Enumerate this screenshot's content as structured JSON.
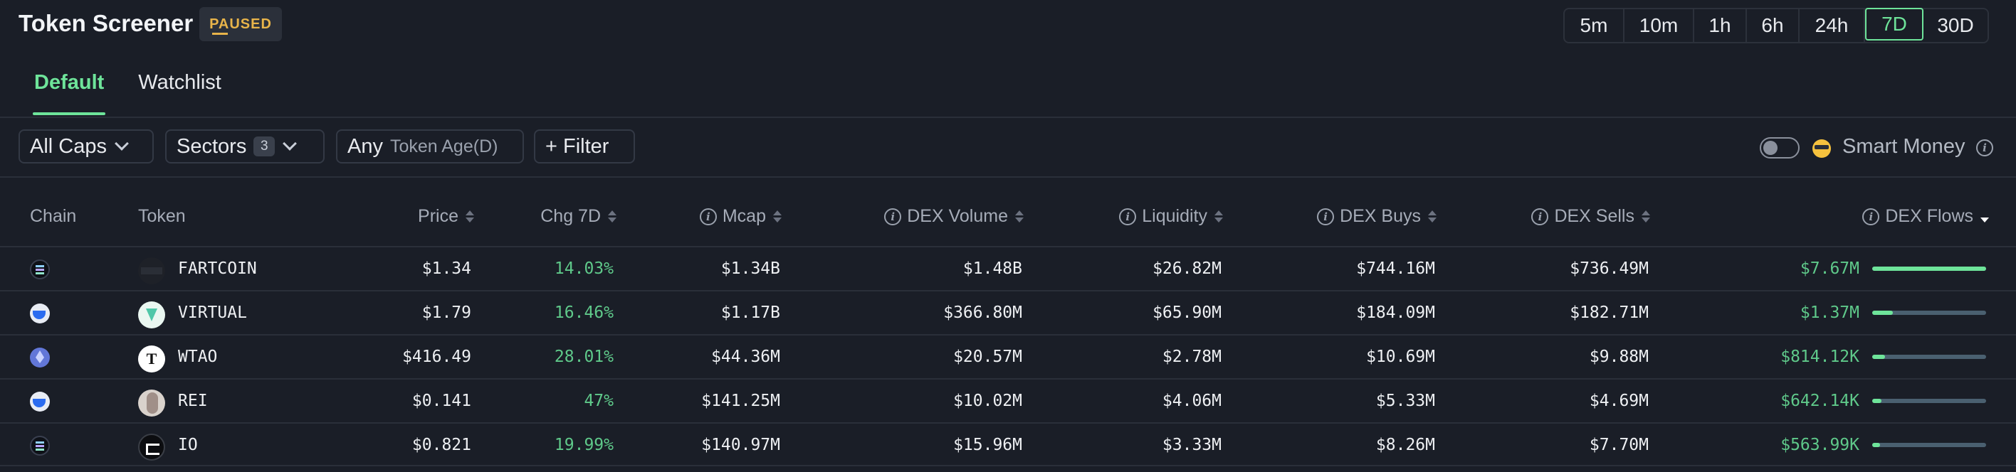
{
  "header": {
    "title": "Token Screener",
    "badge": "PAUSED",
    "timeframes": [
      "5m",
      "10m",
      "1h",
      "6h",
      "24h",
      "7D",
      "30D"
    ],
    "active_timeframe": "7D"
  },
  "tabs": [
    {
      "label": "Default",
      "active": true
    },
    {
      "label": "Watchlist",
      "active": false
    }
  ],
  "filters": {
    "caps": "All Caps",
    "sectors": "Sectors",
    "sectors_count": "3",
    "age_prefix": "Any",
    "age_label": "Token Age(D)",
    "filter_label": "+ Filter",
    "smart_money_label": "Smart Money",
    "smart_money_enabled": false
  },
  "columns": {
    "chain": "Chain",
    "token": "Token",
    "price": "Price",
    "chg": "Chg 7D",
    "mcap": "Mcap",
    "volume": "DEX Volume",
    "liquidity": "Liquidity",
    "buys": "DEX Buys",
    "sells": "DEX Sells",
    "flows": "DEX Flows"
  },
  "rows": [
    {
      "chain": "solana-icon",
      "token": "FARTCOIN",
      "price": "$1.34",
      "chg": "14.03%",
      "mcap": "$1.34B",
      "volume": "$1.48B",
      "liquidity": "$26.82M",
      "buys": "$744.16M",
      "sells": "$736.49M",
      "flows": "$7.67M",
      "flow_level": 1.0
    },
    {
      "chain": "base-icon",
      "token": "VIRTUAL",
      "price": "$1.79",
      "chg": "16.46%",
      "mcap": "$1.17B",
      "volume": "$366.80M",
      "liquidity": "$65.90M",
      "buys": "$184.09M",
      "sells": "$182.71M",
      "flows": "$1.37M",
      "flow_level": 0.18
    },
    {
      "chain": "ethereum-icon",
      "token": "WTAO",
      "price": "$416.49",
      "chg": "28.01%",
      "mcap": "$44.36M",
      "volume": "$20.57M",
      "liquidity": "$2.78M",
      "buys": "$10.69M",
      "sells": "$9.88M",
      "flows": "$814.12K",
      "flow_level": 0.11
    },
    {
      "chain": "base-icon",
      "token": "REI",
      "price": "$0.141",
      "chg": "47%",
      "mcap": "$141.25M",
      "volume": "$10.02M",
      "liquidity": "$4.06M",
      "buys": "$5.33M",
      "sells": "$4.69M",
      "flows": "$642.14K",
      "flow_level": 0.08
    },
    {
      "chain": "solana-icon",
      "token": "IO",
      "price": "$0.821",
      "chg": "19.99%",
      "mcap": "$140.97M",
      "volume": "$15.96M",
      "liquidity": "$3.33M",
      "buys": "$8.26M",
      "sells": "$7.70M",
      "flows": "$563.99K",
      "flow_level": 0.07
    }
  ]
}
